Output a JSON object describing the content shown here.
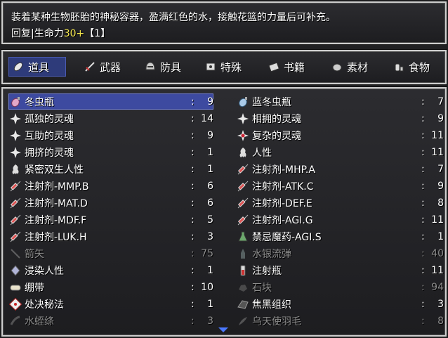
{
  "help": {
    "line1": "装着某种生物胚胎的神秘容器，盈满红色的水，接触花篮的力量后可补充。",
    "line2_prefix": "回复|生命力",
    "line2_value": "30+",
    "line2_suffix": "【1】"
  },
  "categories": [
    {
      "label": "道具",
      "icon": "pill-icon",
      "active": true
    },
    {
      "label": "武器",
      "icon": "sword-icon",
      "active": false
    },
    {
      "label": "防具",
      "icon": "helmet-icon",
      "active": false
    },
    {
      "label": "特殊",
      "icon": "cube-icon",
      "active": false
    },
    {
      "label": "书籍",
      "icon": "book-icon",
      "active": false
    },
    {
      "label": "素材",
      "icon": "stone-icon",
      "active": false
    },
    {
      "label": "食物",
      "icon": "bottle-icon",
      "active": false
    }
  ],
  "items_left": [
    {
      "name": "冬虫瓶",
      "count": "9",
      "icon": "flask-icon",
      "selected": true,
      "dim": false
    },
    {
      "name": "孤独的灵魂",
      "count": "14",
      "icon": "soul-icon",
      "dim": false
    },
    {
      "name": "互助的灵魂",
      "count": "9",
      "icon": "soul-icon",
      "dim": false
    },
    {
      "name": "拥挤的灵魂",
      "count": "1",
      "icon": "soul-icon",
      "dim": false
    },
    {
      "name": "紧密双生人性",
      "count": "1",
      "icon": "humanity-icon",
      "dim": false
    },
    {
      "name": "注射剂-MMP.B",
      "count": "6",
      "icon": "syringe-icon",
      "dim": false
    },
    {
      "name": "注射剂-MAT.D",
      "count": "6",
      "icon": "syringe-icon",
      "dim": false
    },
    {
      "name": "注射剂-MDF.F",
      "count": "5",
      "icon": "syringe-icon",
      "dim": false
    },
    {
      "name": "注射剂-LUK.H",
      "count": "3",
      "icon": "syringe-icon",
      "dim": false
    },
    {
      "name": "箭矢",
      "count": "75",
      "icon": "arrow-icon",
      "dim": true
    },
    {
      "name": "浸染人性",
      "count": "1",
      "icon": "crystal-icon",
      "dim": false
    },
    {
      "name": "绷带",
      "count": "10",
      "icon": "bandage-icon",
      "dim": false
    },
    {
      "name": "处决秘法",
      "count": "1",
      "icon": "scroll-icon",
      "dim": false
    },
    {
      "name": "水蛭绦",
      "count": "3",
      "icon": "leech-icon",
      "dim": true
    }
  ],
  "items_right": [
    {
      "name": "蓝冬虫瓶",
      "count": "7",
      "icon": "flask-blue-icon",
      "dim": false
    },
    {
      "name": "相拥的灵魂",
      "count": "9",
      "icon": "soul-icon",
      "dim": false
    },
    {
      "name": "复杂的灵魂",
      "count": "11",
      "icon": "soul-red-icon",
      "dim": false
    },
    {
      "name": "人性",
      "count": "11",
      "icon": "humanity-icon",
      "dim": false
    },
    {
      "name": "注射剂-MHP.A",
      "count": "7",
      "icon": "syringe-icon",
      "dim": false
    },
    {
      "name": "注射剂-ATK.C",
      "count": "9",
      "icon": "syringe-icon",
      "dim": false
    },
    {
      "name": "注射剂-DEF.E",
      "count": "8",
      "icon": "syringe-icon",
      "dim": false
    },
    {
      "name": "注射剂-AGI.G",
      "count": "11",
      "icon": "syringe-icon",
      "dim": false
    },
    {
      "name": "禁忌魔药-AGI.S",
      "count": "1",
      "icon": "potion-icon",
      "dim": false
    },
    {
      "name": "水银流弹",
      "count": "40",
      "icon": "bullet-icon",
      "dim": true
    },
    {
      "name": "注射瓶",
      "count": "11",
      "icon": "vial-icon",
      "dim": false
    },
    {
      "name": "石块",
      "count": "94",
      "icon": "rock-icon",
      "dim": true
    },
    {
      "name": "焦黑组织",
      "count": "3",
      "icon": "tissue-icon",
      "dim": false
    },
    {
      "name": "乌天使羽毛",
      "count": "8",
      "icon": "feather-icon",
      "dim": true
    }
  ],
  "colon": ":"
}
